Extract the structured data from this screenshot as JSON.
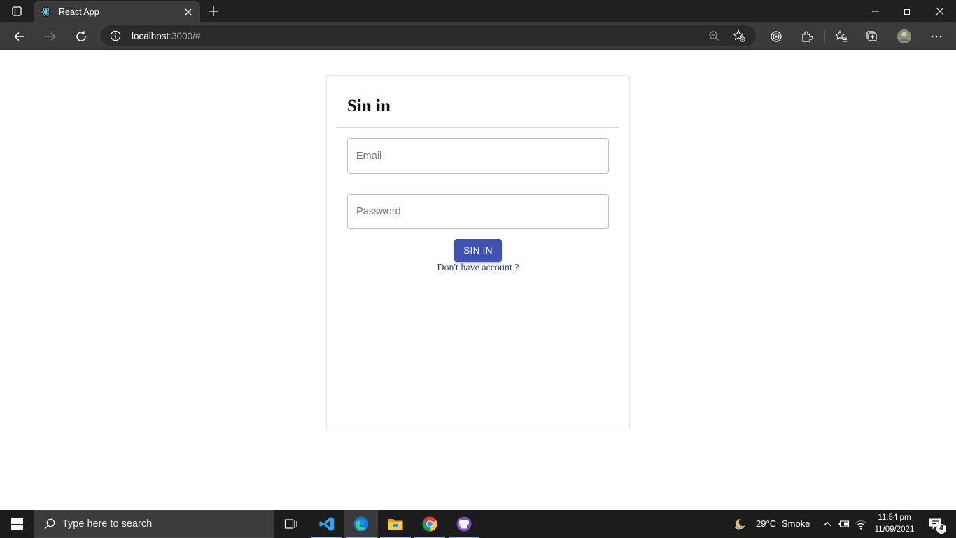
{
  "browser": {
    "tab": {
      "title": "React App",
      "favicon": "react-icon"
    },
    "address": {
      "host": "localhost",
      "rest": ":3000/#"
    }
  },
  "signin": {
    "title": "Sin in",
    "email_placeholder": "Email",
    "password_placeholder": "Password",
    "submit_label": "SIN IN",
    "signup_link": "Don't have account ?"
  },
  "taskbar": {
    "search_placeholder": "Type here to search",
    "apps": [
      "task-view-icon",
      "vscode-icon",
      "edge-icon",
      "file-explorer-icon",
      "chrome-icon",
      "github-desktop-icon"
    ],
    "weather": {
      "temp": "29°C",
      "condition": "Smoke"
    },
    "clock": {
      "time": "11:54 pm",
      "date": "11/09/2021"
    },
    "notification_count": "4"
  },
  "colors": {
    "primary_button": "#3f51b5",
    "link": "#2f3e96",
    "chrome_dark": "#202020",
    "toolbar": "#3b3b3b"
  }
}
